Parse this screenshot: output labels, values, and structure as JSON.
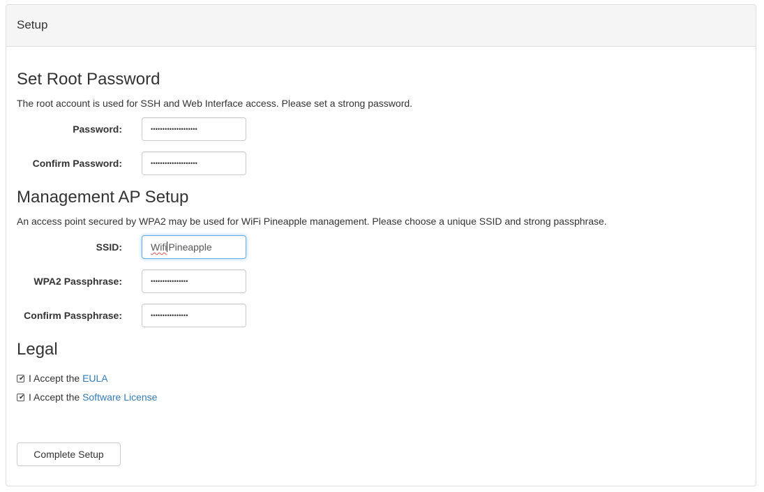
{
  "panel": {
    "title": "Setup"
  },
  "root_password": {
    "heading": "Set Root Password",
    "description": "The root account is used for SSH and Web Interface access. Please set a strong password.",
    "password_label": "Password:",
    "password_value": "••••••••••••••••••••",
    "confirm_label": "Confirm Password:",
    "confirm_value": "••••••••••••••••••••"
  },
  "management_ap": {
    "heading": "Management AP Setup",
    "description": "An access point secured by WPA2 may be used for WiFi Pineapple management. Please choose a unique SSID and strong passphrase.",
    "ssid_label": "SSID:",
    "ssid_value_part1": "Wifi",
    "ssid_value_part2": "Pineapple",
    "wpa2_label": "WPA2 Passphrase:",
    "wpa2_value": "••••••••••••••••",
    "confirm_label": "Confirm Passphrase:",
    "confirm_value": "••••••••••••••••"
  },
  "legal": {
    "heading": "Legal",
    "eula_prefix": "I Accept the ",
    "eula_link": "EULA",
    "eula_checked": true,
    "license_prefix": "I Accept the ",
    "license_link": "Software License",
    "license_checked": true
  },
  "actions": {
    "complete_label": "Complete Setup"
  },
  "colors": {
    "link": "#337ab7",
    "focus_border": "#66afe9",
    "panel_heading_bg": "#f5f5f5"
  }
}
